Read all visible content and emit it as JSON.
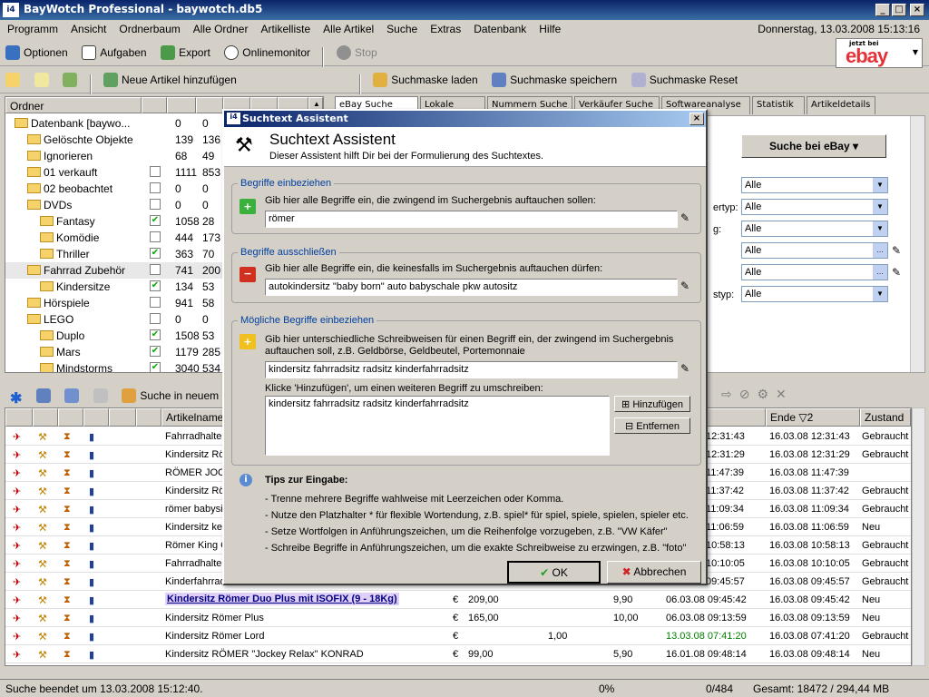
{
  "app": {
    "title": "BayWotch Professional - baywotch.db5",
    "icon_label": "i4"
  },
  "menu": [
    "Programm",
    "Ansicht",
    "Ordnerbaum",
    "Alle Ordner",
    "Artikelliste",
    "Alle Artikel",
    "Suche",
    "Extras",
    "Datenbank",
    "Hilfe"
  ],
  "datetime": "Donnerstag, 13.03.2008 15:13:16",
  "toolbar1": {
    "options": "Optionen",
    "tasks": "Aufgaben",
    "export": "Export",
    "monitor": "Onlinemonitor",
    "stop": "Stop"
  },
  "ebay_badge": {
    "small": "jetzt bei",
    "brand": "ebay"
  },
  "toolbar2": {
    "add": "Neue Artikel hinzufügen",
    "load": "Suchmaske laden",
    "save": "Suchmaske speichern",
    "reset": "Suchmaske Reset"
  },
  "tree": {
    "header": "Ordner",
    "rows": [
      {
        "label": "Datenbank [baywo...",
        "c1": "0",
        "c2": "0",
        "checked": null
      },
      {
        "label": "Gelöschte Objekte",
        "c1": "139",
        "c2": "136",
        "checked": null
      },
      {
        "label": "Ignorieren",
        "c1": "68",
        "c2": "49",
        "checked": null
      },
      {
        "label": "01 verkauft",
        "c1": "1111",
        "c2": "853",
        "checked": false
      },
      {
        "label": "02 beobachtet",
        "c1": "0",
        "c2": "0",
        "checked": false
      },
      {
        "label": "DVDs",
        "c1": "0",
        "c2": "0",
        "checked": false
      },
      {
        "label": "Fantasy",
        "c1": "1058",
        "c2": "28",
        "checked": true
      },
      {
        "label": "Komödie",
        "c1": "444",
        "c2": "173",
        "checked": false
      },
      {
        "label": "Thriller",
        "c1": "363",
        "c2": "70",
        "checked": true
      },
      {
        "label": "Fahrrad Zubehör",
        "c1": "741",
        "c2": "200",
        "checked": false
      },
      {
        "label": "Kindersitze",
        "c1": "134",
        "c2": "53",
        "checked": true
      },
      {
        "label": "Hörspiele",
        "c1": "941",
        "c2": "58",
        "checked": false
      },
      {
        "label": "LEGO",
        "c1": "0",
        "c2": "0",
        "checked": false
      },
      {
        "label": "Duplo",
        "c1": "1508",
        "c2": "53",
        "checked": true
      },
      {
        "label": "Mars",
        "c1": "1179",
        "c2": "285",
        "checked": true
      },
      {
        "label": "Mindstorms",
        "c1": "3040",
        "c2": "534",
        "checked": true
      }
    ]
  },
  "tabs": [
    "eBay Suche",
    "Lokale Suche",
    "Nummern Suche",
    "Verkäufer Suche",
    "Softwareanalyse",
    "Statistik",
    "Artikeldetails"
  ],
  "search_panel": {
    "search_button": "Suche bei eBay",
    "selects": [
      "Alle",
      "Alle",
      "Alle",
      "Alle",
      "Alle",
      "Alle"
    ],
    "labels": [
      "ertyp:",
      "g:",
      "styp:"
    ]
  },
  "list": {
    "search_new": "Suche in neuem Ord",
    "headers": {
      "name": "Artikelname",
      "end": "Ende ▽2",
      "state": "Zustand"
    },
    "rows": [
      {
        "name": "Fahrradhalte",
        "time": "12:31:43",
        "end": "16.03.08 12:31:43",
        "state": "Gebraucht"
      },
      {
        "name": "Kindersitz Rö",
        "time": "12:31:29",
        "end": "16.03.08 12:31:29",
        "state": "Gebraucht"
      },
      {
        "name": "RÖMER JOCK",
        "time": "11:47:39",
        "end": "16.03.08 11:47:39",
        "state": ""
      },
      {
        "name": "Kindersitz Rö",
        "time": "11:37:42",
        "end": "16.03.08 11:37:42",
        "state": "Gebraucht"
      },
      {
        "name": "römer babysi",
        "time": "11:09:34",
        "end": "16.03.08 11:09:34",
        "state": "Gebraucht"
      },
      {
        "name": "Kindersitz  ke",
        "time": "11:06:59",
        "end": "16.03.08 11:06:59",
        "state": "Neu"
      },
      {
        "name": "Römer King C",
        "time": "10:58:13",
        "end": "16.03.08 10:58:13",
        "state": "Gebraucht"
      },
      {
        "name": "Fahrradhalte",
        "time": "10:10:05",
        "end": "16.03.08 10:10:05",
        "state": "Gebraucht"
      },
      {
        "name": "Kinderfahrradsitz von Römer",
        "time": "09:45:57",
        "end": "16.03.08 09:45:57",
        "state": "Gebraucht"
      },
      {
        "name": "Kindersitz Römer Duo Plus mit ISOFIX  (9 - 18Kg)",
        "cur": "€",
        "price": "209,00",
        "ship": "9,90",
        "time": "06.03.08 09:45:42",
        "end": "16.03.08 09:45:42",
        "state": "Neu"
      },
      {
        "name": "Kindersitz Römer Plus",
        "cur": "€",
        "price": "165,00",
        "ship": "10,00",
        "time": "06.03.08 09:13:59",
        "end": "16.03.08 09:13:59",
        "state": "Neu"
      },
      {
        "name": "Kindersitz Römer Lord",
        "cur": "€",
        "price": "",
        "bids": "1,00",
        "time": "13.03.08 07:41:20",
        "end": "16.03.08 07:41:20",
        "state": "Gebraucht"
      },
      {
        "name": "Kindersitz RÖMER \"Jockey Relax\" KONRAD",
        "cur": "€",
        "price": "99,00",
        "ship": "5,90",
        "time": "16.01.08 09:48:14",
        "end": "16.03.08 09:48:14",
        "state": "Neu"
      }
    ]
  },
  "status": {
    "msg": "Suche beendet um 13.03.2008 15:12:40.",
    "pct": "0%",
    "count": "0/484",
    "total": "Gesamt: 18472 / 294,44 MB"
  },
  "dialog": {
    "title": "Suchtext Assistent",
    "heading": "Suchtext Assistent",
    "sub": "Dieser Assistent hilft Dir bei der Formulierung des Suchtextes.",
    "g1": {
      "label": "Begriffe einbeziehen",
      "text": "Gib hier alle Begriffe ein, die zwingend im Suchergebnis auftauchen sollen:",
      "value": "römer"
    },
    "g2": {
      "label": "Begriffe ausschließen",
      "text": "Gib hier alle Begriffe ein, die keinesfalls im Suchergebnis auftauchen dürfen:",
      "value": "autokindersitz \"baby born\" auto babyschale pkw autositz"
    },
    "g3": {
      "label": "Mögliche Begriffe einbeziehen",
      "text1": "Gib hier unterschiedliche Schreibweisen für einen Begriff ein, der zwingend im Suchergebnis",
      "text2": "auftauchen soll, z.B. Geldbörse, Geldbeutel, Portemonnaie",
      "value": "kindersitz fahrradsitz radsitz kinderfahrradsitz",
      "hint": "Klicke 'Hinzufügen', um einen weiteren Begriff zu umschreiben:",
      "list_item": "kindersitz fahrradsitz radsitz kinderfahrradsitz",
      "add": "Hinzufügen",
      "remove": "Entfernen"
    },
    "tips": {
      "title": "Tips zur Eingabe:",
      "items": [
        "- Trenne mehrere Begriffe wahlweise mit Leerzeichen oder Komma.",
        "- Nutze den Platzhalter * für flexible Wortendung, z.B. spiel* für spiel, spiele, spielen, spieler etc.",
        "- Setze Wortfolgen in Anführungszeichen, um die Reihenfolge vorzugeben, z.B. \"VW Käfer\"",
        "- Schreibe Begriffe in Anführungszeichen, um die exakte Schreibweise zu erzwingen, z.B. \"foto\""
      ]
    },
    "ok": "OK",
    "cancel": "Abbrechen"
  }
}
